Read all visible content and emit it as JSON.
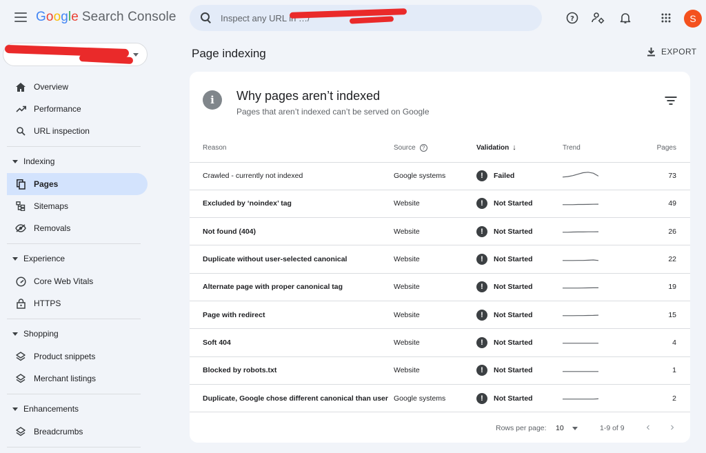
{
  "app": {
    "logo_letters": [
      "G",
      "o",
      "o",
      "g",
      "l",
      "e"
    ],
    "name": "Search Console"
  },
  "search": {
    "placeholder": "Inspect any URL in …/",
    "visible_prefix": "Inspect any UR",
    "visible_suffix": "om/"
  },
  "user": {
    "avatar_letter": "S",
    "avatar_color": "#f4511e"
  },
  "sidebar": {
    "top_items": [
      {
        "label": "Overview",
        "icon": "home-icon"
      },
      {
        "label": "Performance",
        "icon": "trending-up-icon"
      },
      {
        "label": "URL inspection",
        "icon": "search-icon"
      }
    ],
    "sections": [
      {
        "label": "Indexing",
        "items": [
          {
            "label": "Pages",
            "icon": "pages-icon",
            "active": true
          },
          {
            "label": "Sitemaps",
            "icon": "sitemap-icon"
          },
          {
            "label": "Removals",
            "icon": "removals-icon"
          }
        ]
      },
      {
        "label": "Experience",
        "items": [
          {
            "label": "Core Web Vitals",
            "icon": "gauge-icon"
          },
          {
            "label": "HTTPS",
            "icon": "lock-icon"
          }
        ]
      },
      {
        "label": "Shopping",
        "items": [
          {
            "label": "Product snippets",
            "icon": "layers-icon"
          },
          {
            "label": "Merchant listings",
            "icon": "layers-icon"
          }
        ]
      },
      {
        "label": "Enhancements",
        "items": [
          {
            "label": "Breadcrumbs",
            "icon": "layers-icon"
          }
        ]
      }
    ]
  },
  "main": {
    "title": "Page indexing",
    "export_label": "EXPORT",
    "card": {
      "title": "Why pages aren’t indexed",
      "subtitle": "Pages that aren’t indexed can’t be served on Google",
      "columns": {
        "reason": "Reason",
        "source": "Source",
        "validation": "Validation",
        "trend": "Trend",
        "pages": "Pages"
      },
      "rows": [
        {
          "reason": "Crawled - currently not indexed",
          "source": "Google systems",
          "validation": "Failed",
          "pages": "73",
          "reason_bold": false,
          "trend": [
            0.3,
            0.35,
            0.45,
            0.6,
            0.75,
            0.8,
            0.7,
            0.4
          ]
        },
        {
          "reason": "Excluded by ‘noindex’ tag",
          "source": "Website",
          "validation": "Not Started",
          "pages": "49",
          "reason_bold": true,
          "trend": [
            0.3,
            0.3,
            0.3,
            0.32,
            0.32,
            0.33,
            0.34,
            0.35
          ]
        },
        {
          "reason": "Not found (404)",
          "source": "Website",
          "validation": "Not Started",
          "pages": "26",
          "reason_bold": true,
          "trend": [
            0.3,
            0.3,
            0.32,
            0.33,
            0.33,
            0.34,
            0.34,
            0.35
          ]
        },
        {
          "reason": "Duplicate without user-selected canonical",
          "source": "Website",
          "validation": "Not Started",
          "pages": "22",
          "reason_bold": true,
          "trend": [
            0.3,
            0.3,
            0.3,
            0.31,
            0.31,
            0.33,
            0.36,
            0.3
          ]
        },
        {
          "reason": "Alternate page with proper canonical tag",
          "source": "Website",
          "validation": "Not Started",
          "pages": "19",
          "reason_bold": true,
          "trend": [
            0.3,
            0.3,
            0.3,
            0.3,
            0.31,
            0.32,
            0.33,
            0.33
          ]
        },
        {
          "reason": "Page with redirect",
          "source": "Website",
          "validation": "Not Started",
          "pages": "15",
          "reason_bold": true,
          "trend": [
            0.3,
            0.3,
            0.3,
            0.31,
            0.31,
            0.32,
            0.33,
            0.35
          ]
        },
        {
          "reason": "Soft 404",
          "source": "Website",
          "validation": "Not Started",
          "pages": "4",
          "reason_bold": true,
          "trend": [
            0.3,
            0.3,
            0.3,
            0.3,
            0.3,
            0.3,
            0.3,
            0.3
          ]
        },
        {
          "reason": "Blocked by robots.txt",
          "source": "Website",
          "validation": "Not Started",
          "pages": "1",
          "reason_bold": true,
          "trend": [
            0.3,
            0.3,
            0.3,
            0.3,
            0.3,
            0.3,
            0.3,
            0.3
          ]
        },
        {
          "reason": "Duplicate, Google chose different canonical than user",
          "source": "Google systems",
          "validation": "Not Started",
          "pages": "2",
          "reason_bold": true,
          "trend": [
            0.3,
            0.3,
            0.3,
            0.3,
            0.3,
            0.3,
            0.3,
            0.33
          ]
        }
      ]
    },
    "pagination": {
      "rows_per_page_label": "Rows per page:",
      "rows_per_page": "10",
      "range": "1-9 of 9"
    }
  }
}
